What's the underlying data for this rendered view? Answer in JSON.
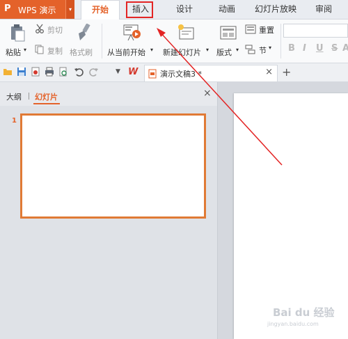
{
  "app": {
    "logo": "P",
    "title": "WPS 演示",
    "caret": "▾"
  },
  "tabs": [
    {
      "label": "开始"
    },
    {
      "label": "插入"
    },
    {
      "label": "设计"
    },
    {
      "label": "动画"
    },
    {
      "label": "幻灯片放映"
    },
    {
      "label": "审阅"
    }
  ],
  "ribbon": {
    "paste": "粘贴",
    "paste_caret": "▾",
    "cut": "剪切",
    "copy": "复制",
    "format_painter": "格式刷",
    "from_current": "从当前开始",
    "new_slide": "新建幻灯片",
    "layout": "版式",
    "reset": "重置",
    "section": "节",
    "bold": "B",
    "italic": "I",
    "underline": "U",
    "strike": "S"
  },
  "document": {
    "title": "演示文稿3 *",
    "close": "×",
    "new_tab": "+",
    "wps_logo": "W"
  },
  "panel": {
    "outline_tab": "大纲",
    "slides_tab": "幻灯片",
    "close": "×",
    "slide_number": "1"
  },
  "watermark": {
    "text": "Bai du 经验",
    "url": "jingyan.baidu.com"
  },
  "colors": {
    "accent": "#e4622a",
    "highlight": "#e32424"
  }
}
